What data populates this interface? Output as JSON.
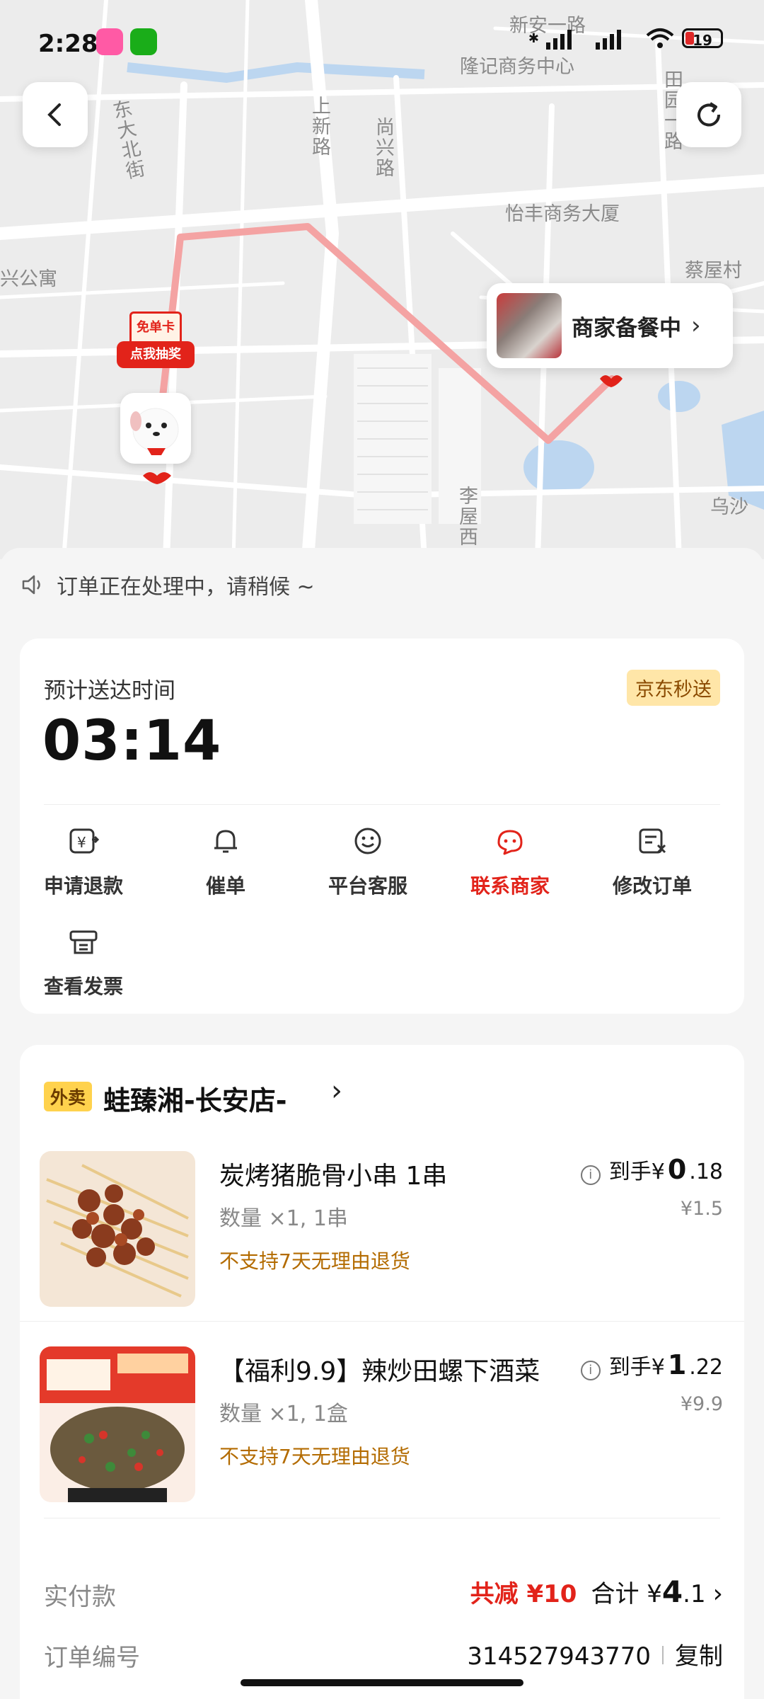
{
  "status_bar": {
    "time": "2:28",
    "battery": "19"
  },
  "map": {
    "streets": [
      "新安一路",
      "隆记商务中心",
      "东大北街",
      "上新路",
      "尚兴路",
      "田园一路",
      "怡丰商务大厦",
      "蔡屋村",
      "兴公寓",
      "李屋西",
      "乌沙"
    ],
    "merchant_status": "商家备餐中",
    "lottery_top": "免单卡",
    "lottery_bottom": "点我抽奖"
  },
  "notice": "订单正在处理中，请稍候 ~",
  "delivery": {
    "eta_label": "预计送达时间",
    "eta_time": "03:14",
    "badge": "京东秒送",
    "actions": [
      {
        "label": "申请退款",
        "icon": "refund-icon"
      },
      {
        "label": "催单",
        "icon": "bell-icon"
      },
      {
        "label": "平台客服",
        "icon": "smile-icon"
      },
      {
        "label": "联系商家",
        "icon": "store-chat-icon",
        "active": true
      },
      {
        "label": "修改订单",
        "icon": "edit-order-icon"
      },
      {
        "label": "查看发票",
        "icon": "invoice-icon"
      }
    ]
  },
  "order": {
    "tag": "外卖",
    "shop_name": "蛙臻湘-长安店-",
    "items": [
      {
        "title": "炭烤猪脆骨小串 1串",
        "qty": "数量 ×1, 1串",
        "policy": "不支持7天无理由退货",
        "price_prefix": "到手¥",
        "price_int": "0",
        "price_dec": ".18",
        "original": "¥1.5"
      },
      {
        "title": "【福利9.9】辣炒田螺下酒菜",
        "qty": "数量 ×1, 1盒",
        "policy": "不支持7天无理由退货",
        "price_prefix": "到手¥",
        "price_int": "1",
        "price_dec": ".22",
        "original": "¥9.9"
      }
    ],
    "paid_label": "实付款",
    "discount": "共减 ¥10",
    "total_prefix": "合计 ¥",
    "total_int": "4",
    "total_dec": ".1",
    "order_no_label": "订单编号",
    "order_no": "314527943770",
    "copy_label": "复制"
  },
  "colors": {
    "accent": "#e2231a",
    "route": "#f4a3a3",
    "badge_bg": "#ffe6a8"
  }
}
